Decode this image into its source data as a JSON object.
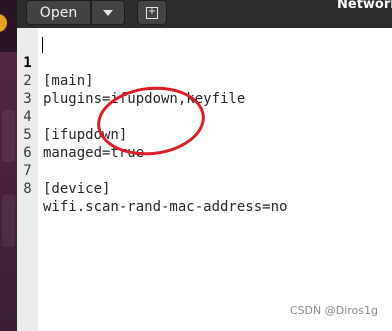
{
  "header": {
    "open_label": "Open",
    "menu_icon": "chevron-down-icon",
    "new_tab_icon": "new-document-icon",
    "title": "Network"
  },
  "editor": {
    "lines": [
      {
        "number": "1",
        "text": "[main]"
      },
      {
        "number": "2",
        "text": "plugins=ifupdown,keyfile"
      },
      {
        "number": "3",
        "text": ""
      },
      {
        "number": "4",
        "text": "[ifupdown]"
      },
      {
        "number": "5",
        "text": "managed=true"
      },
      {
        "number": "6",
        "text": ""
      },
      {
        "number": "7",
        "text": "[device]"
      },
      {
        "number": "8",
        "text": "wifi.scan-rand-mac-address=no"
      }
    ]
  },
  "watermark": "CSDN @Diros1g",
  "colors": {
    "headerbar": "#2c2c2c",
    "button": "#434343",
    "dock": "#4a2240",
    "dock_badge": "#e9a322",
    "gutter": "#ececec",
    "annotation": "#e01b24"
  }
}
